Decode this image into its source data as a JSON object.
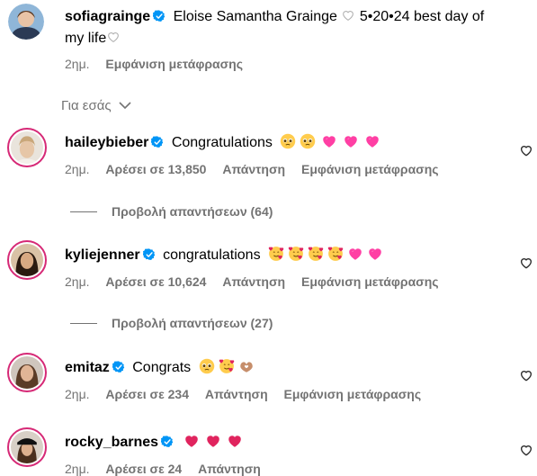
{
  "caption": {
    "username": "sofiagrainge",
    "text": "Eloise Samantha Grainge",
    "text2": "5•20•24 best day of",
    "text3": "my life",
    "time": "2ημ.",
    "translate": "Εμφάνιση μετάφρασης"
  },
  "filter": {
    "label": "Για εσάς"
  },
  "comments": [
    {
      "username": "haileybieber",
      "text": "Congratulations",
      "time": "2ημ.",
      "likes": "Αρέσει σε 13,850",
      "reply": "Απάντηση",
      "translate": "Εμφάνιση μετάφρασης",
      "view_replies": "Προβολή απαντήσεων (64)"
    },
    {
      "username": "kyliejenner",
      "text": "congratulations",
      "time": "2ημ.",
      "likes": "Αρέσει σε 10,624",
      "reply": "Απάντηση",
      "translate": "Εμφάνιση μετάφρασης",
      "view_replies": "Προβολή απαντήσεων (27)"
    },
    {
      "username": "emitaz",
      "text": "Congrats",
      "time": "2ημ.",
      "likes": "Αρέσει σε 234",
      "reply": "Απάντηση",
      "translate": "Εμφάνιση μετάφρασης"
    },
    {
      "username": "rocky_barnes",
      "text": "",
      "time": "2ημ.",
      "likes": "Αρέσει σε 24",
      "reply": "Απάντηση"
    }
  ],
  "colors": {
    "verified": "#0095f6",
    "muted": "#737373",
    "ring": "#d62976",
    "heart_red": "#e0245e",
    "heart_pink": "#ff3fa4"
  }
}
